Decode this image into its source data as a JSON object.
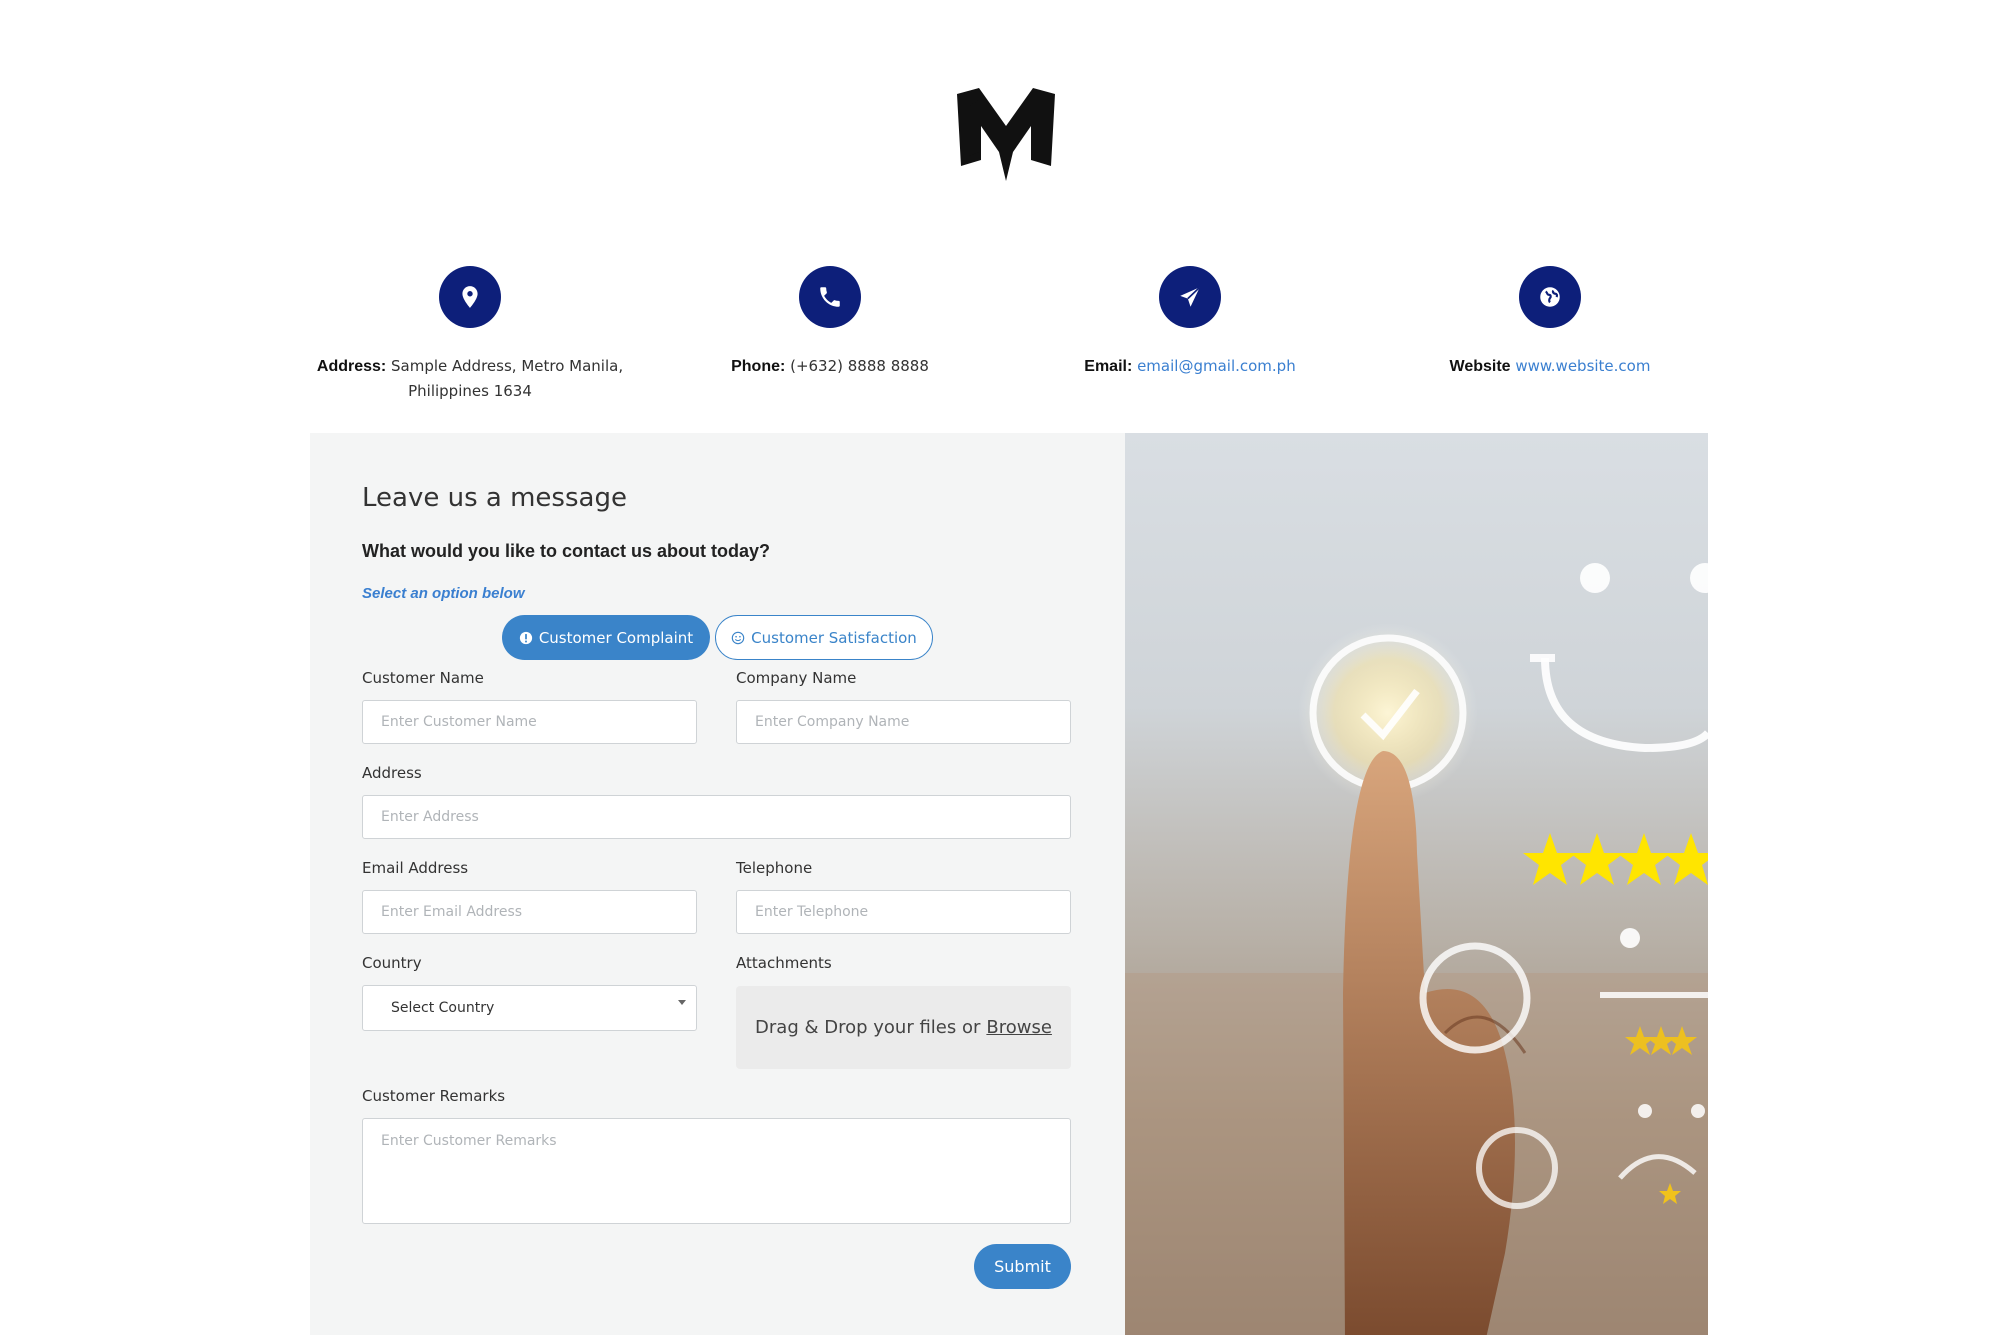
{
  "brand": {
    "logo_icon": "m-logo-icon"
  },
  "contacts": [
    {
      "icon": "location-pin-icon",
      "label": "Address:",
      "value": "Sample Address, Metro Manila,",
      "value2": "Philippines 1634"
    },
    {
      "icon": "phone-icon",
      "label": "Phone:",
      "value": "(+632) 8888 8888"
    },
    {
      "icon": "paper-plane-icon",
      "label": "Email:",
      "value": "email@gmail.com.ph"
    },
    {
      "icon": "globe-icon",
      "label": "Website",
      "value": "www.website.com"
    }
  ],
  "form": {
    "title": "Leave us a message",
    "question": "What would you like to contact us about today?",
    "hint": "Select an option below",
    "options": [
      {
        "label": "Customer Complaint",
        "icon": "exclamation-circle-icon",
        "selected": true
      },
      {
        "label": "Customer Satisfaction",
        "icon": "smile-icon",
        "selected": false
      }
    ],
    "fields": {
      "customer_name": {
        "label": "Customer Name",
        "placeholder": "Enter Customer Name"
      },
      "company_name": {
        "label": "Company Name",
        "placeholder": "Enter Company Name"
      },
      "address": {
        "label": "Address",
        "placeholder": "Enter Address"
      },
      "email": {
        "label": "Email Address",
        "placeholder": "Enter Email Address"
      },
      "telephone": {
        "label": "Telephone",
        "placeholder": "Enter Telephone"
      },
      "country": {
        "label": "Country",
        "value": "Select Country"
      },
      "attachments": {
        "label": "Attachments",
        "text": "Drag & Drop your files or",
        "link": "Browse"
      },
      "remarks": {
        "label": "Customer Remarks",
        "placeholder": "Enter Customer Remarks"
      }
    },
    "submit_label": "Submit"
  },
  "colors": {
    "navy": "#0d1f7a",
    "accent": "#3a84c9",
    "link": "#3a7fd0",
    "panel_bg": "#f4f5f5"
  }
}
